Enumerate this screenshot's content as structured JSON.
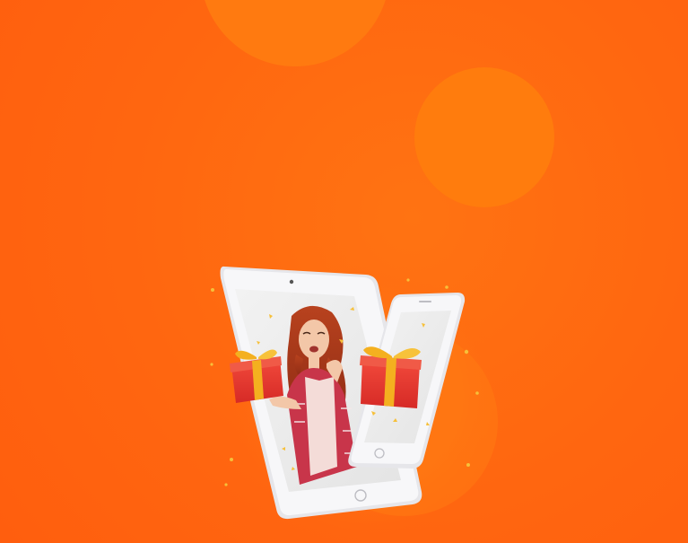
{
  "theme": {
    "background": "#FF6A12",
    "circle_accent": "#FF7A10",
    "gift_red": "#E8322E",
    "ribbon_gold": "#F4B01F",
    "device_frame": "#F4F4F6",
    "screen_bg": "#EDEDED"
  },
  "illustration": {
    "subject": "woman-holding-gift",
    "devices": [
      "tablet",
      "smartphone"
    ],
    "icons": [
      "gift-icon",
      "confetti-icon"
    ]
  }
}
